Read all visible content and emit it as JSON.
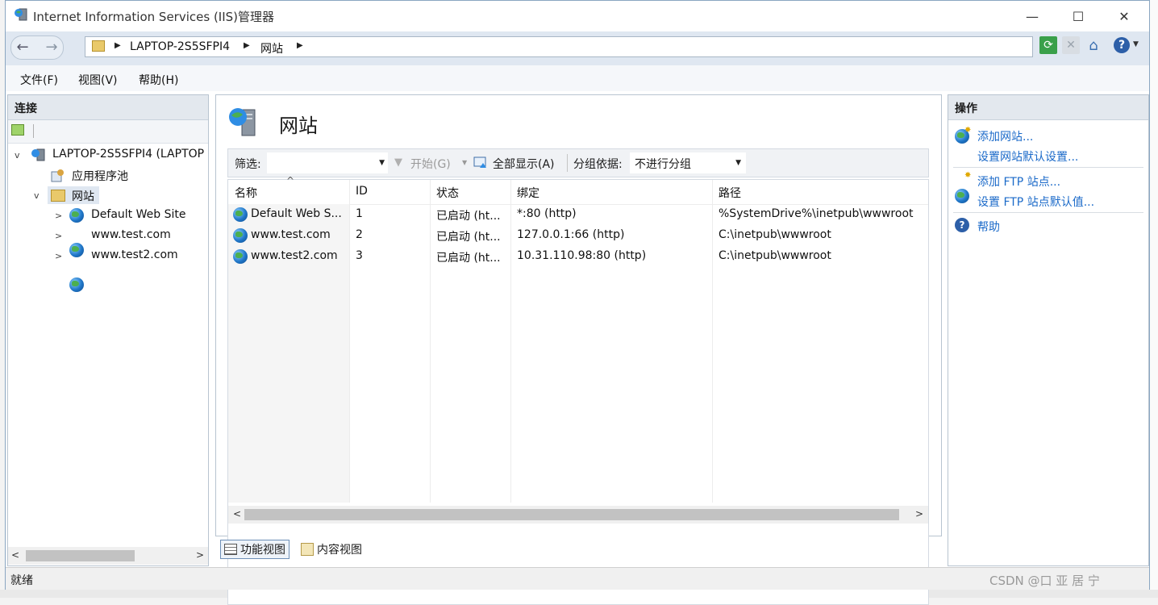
{
  "window": {
    "title": "Internet Information Services (IIS)管理器",
    "minimize": "—",
    "maximize": "☐",
    "close": "✕"
  },
  "address": {
    "crumbs": [
      "LAPTOP-2S5SFPI4",
      "网站"
    ],
    "arrow": "▶"
  },
  "menu": [
    "文件(F)",
    "视图(V)",
    "帮助(H)"
  ],
  "connections": {
    "header": "连接",
    "tree": {
      "server": "LAPTOP-2S5SFPI4 (LAPTOP",
      "app_pools": "应用程序池",
      "sites": "网站",
      "site_items": [
        "Default Web Site",
        "www.test.com",
        "www.test2.com"
      ]
    }
  },
  "main": {
    "title": "网站",
    "filter_label": "筛选:",
    "start_label": "开始(G)",
    "show_all_label": "全部显示(A)",
    "group_by_label": "分组依据:",
    "group_by_value": "不进行分组",
    "columns": [
      "名称",
      "ID",
      "状态",
      "绑定",
      "路径"
    ],
    "rows": [
      {
        "name": "Default Web S...",
        "id": "1",
        "status": "已启动 (ht...",
        "binding": "*:80 (http)",
        "path": "%SystemDrive%\\inetpub\\wwwroot"
      },
      {
        "name": "www.test.com",
        "id": "2",
        "status": "已启动 (ht...",
        "binding": "127.0.0.1:66 (http)",
        "path": "C:\\inetpub\\wwwroot"
      },
      {
        "name": "www.test2.com",
        "id": "3",
        "status": "已启动 (ht...",
        "binding": "10.31.110.98:80 (http)",
        "path": "C:\\inetpub\\wwwroot"
      }
    ]
  },
  "view_tabs": {
    "features": "功能视图",
    "content": "内容视图"
  },
  "actions": {
    "header": "操作",
    "add_site": "添加网站...",
    "site_defaults": "设置网站默认设置...",
    "add_ftp": "添加 FTP 站点...",
    "ftp_defaults": "设置 FTP 站点默认值...",
    "help": "帮助"
  },
  "status": {
    "text": "就绪"
  },
  "watermark": "CSDN @口 亚    居  宁",
  "colors": {
    "link": "#1b6ac9",
    "pane_header": "#e3e8ee",
    "selected": "#dfe7f1"
  }
}
